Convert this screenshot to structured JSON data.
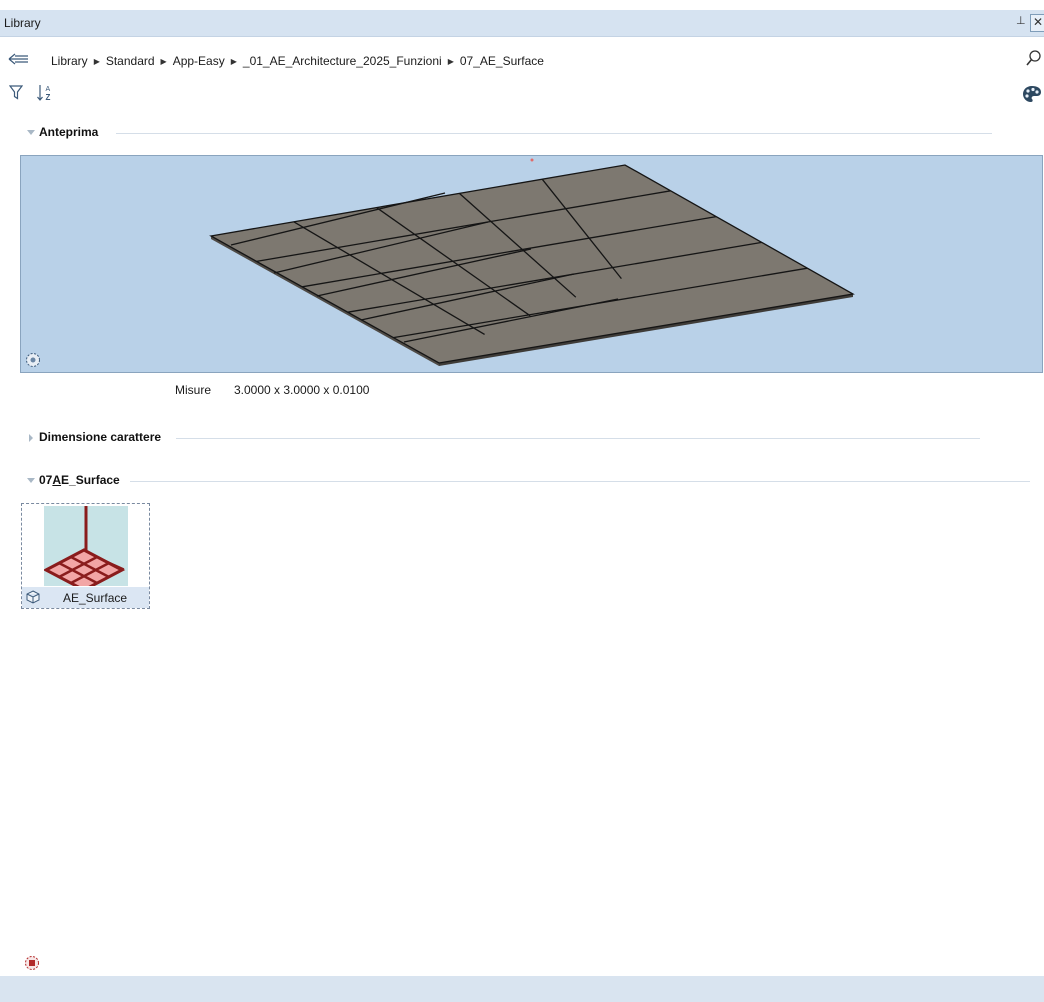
{
  "window": {
    "title": "Library",
    "pin": "⊥",
    "close": "✕"
  },
  "breadcrumb": [
    "Library",
    "Standard",
    "App-Easy",
    "_01_AE_Architecture_2025_Funzioni",
    "07_AE_Surface"
  ],
  "icons": {
    "back": "back-arrow-icon",
    "search": "search-icon",
    "filter": "filter-icon",
    "sort": "sort-az-icon",
    "palette": "palette-icon",
    "preview_control": "view-control-icon",
    "item_type": "3d-cube-icon",
    "bottom_tool": "snap-point-icon"
  },
  "sections": {
    "preview": {
      "title": "Anteprima",
      "expanded": true
    },
    "dimension": {
      "title": "Dimensione carattere",
      "expanded": false
    },
    "folder": {
      "title_prefix": "07",
      "title_accel": "A",
      "title_suffix": "E_Surface",
      "expanded": true
    }
  },
  "preview": {
    "measure_label": "Misure",
    "measure_value": "3.0000 x 3.0000 x 0.0100",
    "background_color": "#b9d1e8",
    "surface_color": "#7d7870"
  },
  "items": [
    {
      "label": "AE_Surface"
    }
  ],
  "colors": {
    "accent": "#b22a2a",
    "titlebar": "#d6e3f1",
    "statusbar": "#d9e4f0"
  }
}
